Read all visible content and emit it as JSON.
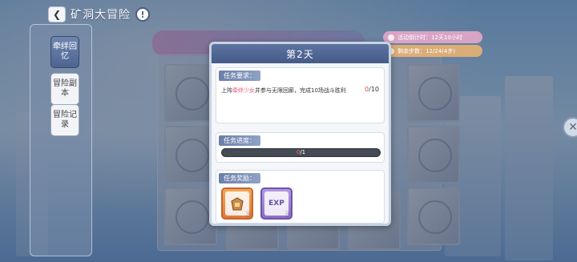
{
  "header": {
    "back_icon": "chevron-left-icon",
    "title": "矿洞大冒险",
    "info_icon": "info-icon",
    "info_glyph": "!"
  },
  "sidebar": {
    "items": [
      {
        "label": "牵绊回忆",
        "active": true
      },
      {
        "label": "冒险副本",
        "active": false
      },
      {
        "label": "冒险记录",
        "active": false
      }
    ]
  },
  "info_pills": [
    {
      "label": "活动倒计时：12天10小时"
    },
    {
      "label": "剩余步数：12/24(4步)"
    }
  ],
  "dialog": {
    "title": "第2天",
    "requirement": {
      "label": "任务要求：",
      "text_prefix": "上阵",
      "text_highlight": "牵绊少女",
      "text_suffix": "并参与无限回廊，完成10场战斗胜利",
      "count_current": "0",
      "count_total": "/10"
    },
    "progress": {
      "label": "任务进度：",
      "current": "0",
      "total": "/1",
      "fraction": 0
    },
    "rewards": {
      "label": "任务奖励：",
      "items": [
        {
          "icon": "treasure-bag-icon",
          "qty": "1"
        },
        {
          "icon": "exp-book-icon",
          "text": "EXP",
          "qty": "1"
        }
      ]
    }
  },
  "close_icon": "close-icon",
  "close_glyph": "✕"
}
